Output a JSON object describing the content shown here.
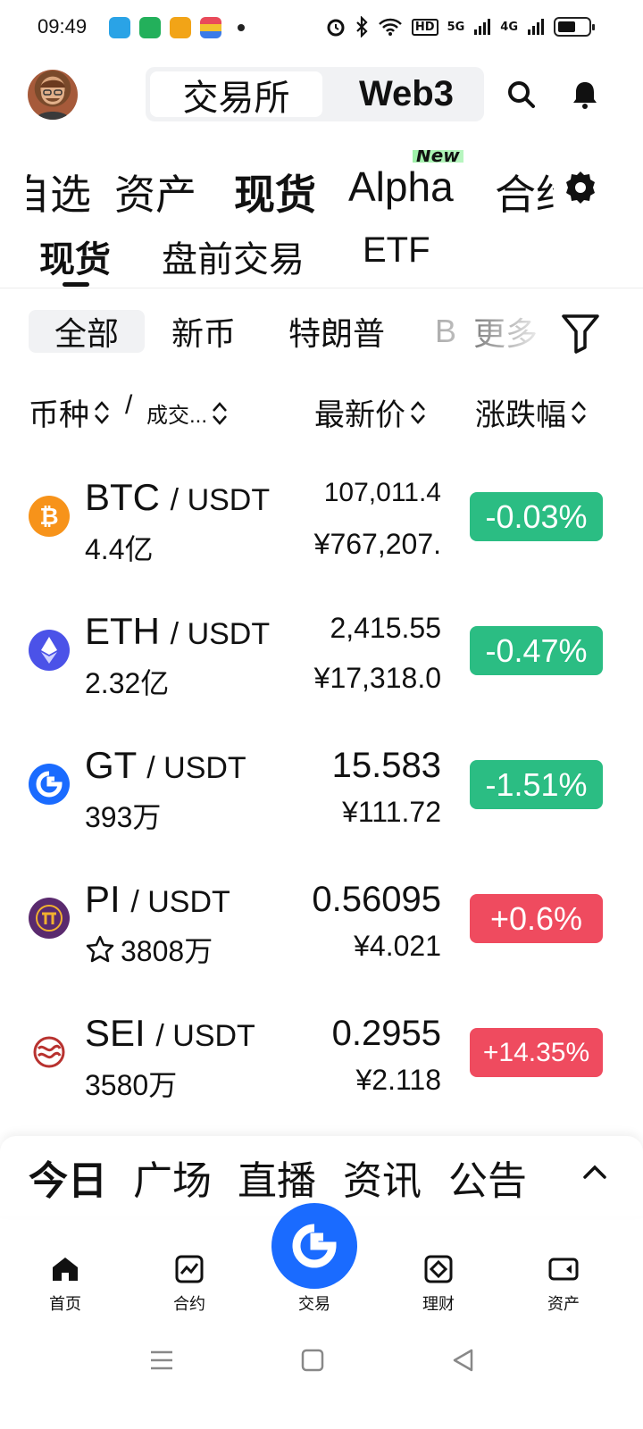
{
  "status_bar": {
    "time": "09:49",
    "signal1": "5G",
    "signal2": "4G",
    "hd": "HD",
    "battery_level": 0.55
  },
  "header": {
    "segments": [
      "交易所",
      "Web3"
    ],
    "active_segment": "交易所"
  },
  "top_nav": {
    "items": [
      "自选",
      "资产",
      "现货",
      "Alpha",
      "合约"
    ],
    "new_badge": "New"
  },
  "sub_tabs": [
    "现货",
    "盘前交易",
    "ETF"
  ],
  "filter_chips": [
    "全部",
    "新币",
    "特朗普",
    "B",
    "更多"
  ],
  "columns": {
    "coin": "币种",
    "volume": "成交...",
    "price": "最新价",
    "change": "涨跌幅"
  },
  "markets": [
    {
      "base": "BTC",
      "quote": "/ USDT",
      "volume": "4.4亿",
      "price": "107,011.4",
      "fiat": "¥767,207.",
      "change": "-0.03%",
      "direction": "down",
      "icon": "btc-icon",
      "icon_color": "#f7931a",
      "favorite": false
    },
    {
      "base": "ETH",
      "quote": "/ USDT",
      "volume": "2.32亿",
      "price": "2,415.55",
      "fiat": "¥17,318.0",
      "change": "-0.47%",
      "direction": "down",
      "icon": "eth-icon",
      "icon_color": "#4b52e8",
      "favorite": false
    },
    {
      "base": "GT",
      "quote": "/ USDT",
      "volume": "393万",
      "price": "15.583",
      "fiat": "¥111.72",
      "change": "-1.51%",
      "direction": "down",
      "icon": "gt-icon",
      "icon_color": "#1a6bff",
      "favorite": false
    },
    {
      "base": "PI",
      "quote": "/ USDT",
      "volume": "3808万",
      "price": "0.56095",
      "fiat": "¥4.021",
      "change": "+0.6%",
      "direction": "up",
      "icon": "pi-icon",
      "icon_color": "#5a2a6e",
      "favorite": true
    },
    {
      "base": "SEI",
      "quote": "/ USDT",
      "volume": "3580万",
      "price": "0.2955",
      "fiat": "¥2.118",
      "change": "+14.35%",
      "direction": "up",
      "icon": "sei-icon",
      "icon_color": "#b8322f",
      "favorite": false
    }
  ],
  "bottom_sheet": {
    "tabs": [
      "今日",
      "广场",
      "直播",
      "资讯",
      "公告"
    ],
    "active": "今日"
  },
  "bottom_nav": [
    {
      "label": "首页",
      "icon": "home-icon"
    },
    {
      "label": "合约",
      "icon": "futures-icon"
    },
    {
      "label": "交易",
      "icon": "trade-icon"
    },
    {
      "label": "理财",
      "icon": "earn-icon"
    },
    {
      "label": "资产",
      "icon": "wallet-icon"
    }
  ],
  "colors": {
    "up": "#ef4b5f",
    "down": "#2bbd83",
    "brand": "#1a6bff"
  }
}
